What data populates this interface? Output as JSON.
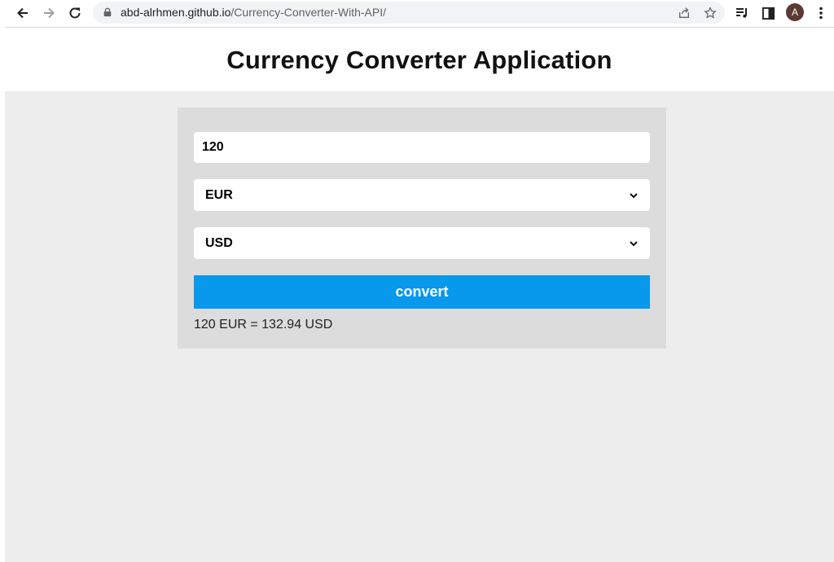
{
  "browser": {
    "url_host": "abd-alrhmen.github.io",
    "url_path": "/Currency-Converter-With-API/",
    "avatar_letter": "A"
  },
  "page": {
    "title": "Currency Converter Application"
  },
  "converter": {
    "amount_value": "120",
    "from_currency": "EUR",
    "to_currency": "USD",
    "convert_label": "convert",
    "result_text": "120 EUR = 132.94 USD",
    "button_color": "#0898ec"
  }
}
